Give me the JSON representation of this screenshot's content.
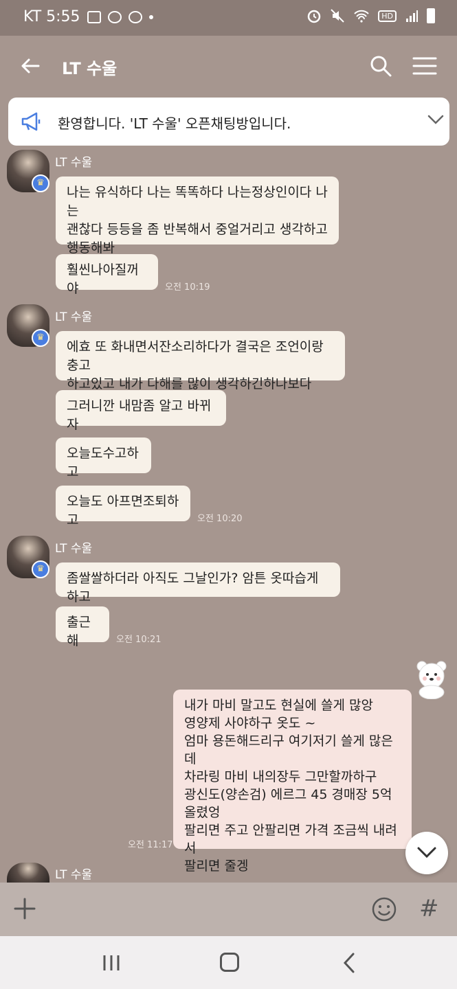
{
  "status": {
    "carrier_time": "KT 5:55",
    "hd": "HD"
  },
  "header": {
    "title": "LT 수울"
  },
  "notice": {
    "text": "환영합니다. 'LT 수울' 오픈채팅방입니다."
  },
  "groups": [
    {
      "sender": "LT 수울",
      "messages": [
        "나는 유식하다 나는 똑똑하다 나는정상인이다 나는\n괜찮다 등등을 좀 반복해서 중얼거리고 생각하고\n행동해봐",
        "훨씬나아질꺼야"
      ],
      "time": "오전 10:19"
    },
    {
      "sender": "LT 수울",
      "messages": [
        "에효 또 화내면서잔소리하다가 결국은 조언이랑충고\n하고있고 내가 다해를 많이 생각하긴하나보다",
        "그러니깐 내맘좀 알고 바뀌자",
        "오늘도수고하고",
        "오늘도 아프면조퇴하고"
      ],
      "time": "오전 10:20"
    },
    {
      "sender": "LT 수울",
      "messages": [
        "좀쌀쌀하더라 아직도 그날인가? 암튼 옷따습게하고",
        "출근해"
      ],
      "time": "오전 10:21"
    }
  ],
  "my_message": {
    "text": "내가 마비 말고도 현실에 쓸게 많앙\n영양제 사야하구 옷도 ~\n엄마 용돈해드리구 여기저기 쓸게 많은데\n차라링 마비 내의장두 그만할까하구\n광신도(양손검) 에르그 45  경매장 5억\n올렸엉\n팔리면 주고 안팔리면 가격 조금씩 내려서\n팔리면  줄겡",
    "time": "오전 11:17"
  },
  "last_sender": "LT 수울",
  "input": {
    "hash": "#"
  }
}
